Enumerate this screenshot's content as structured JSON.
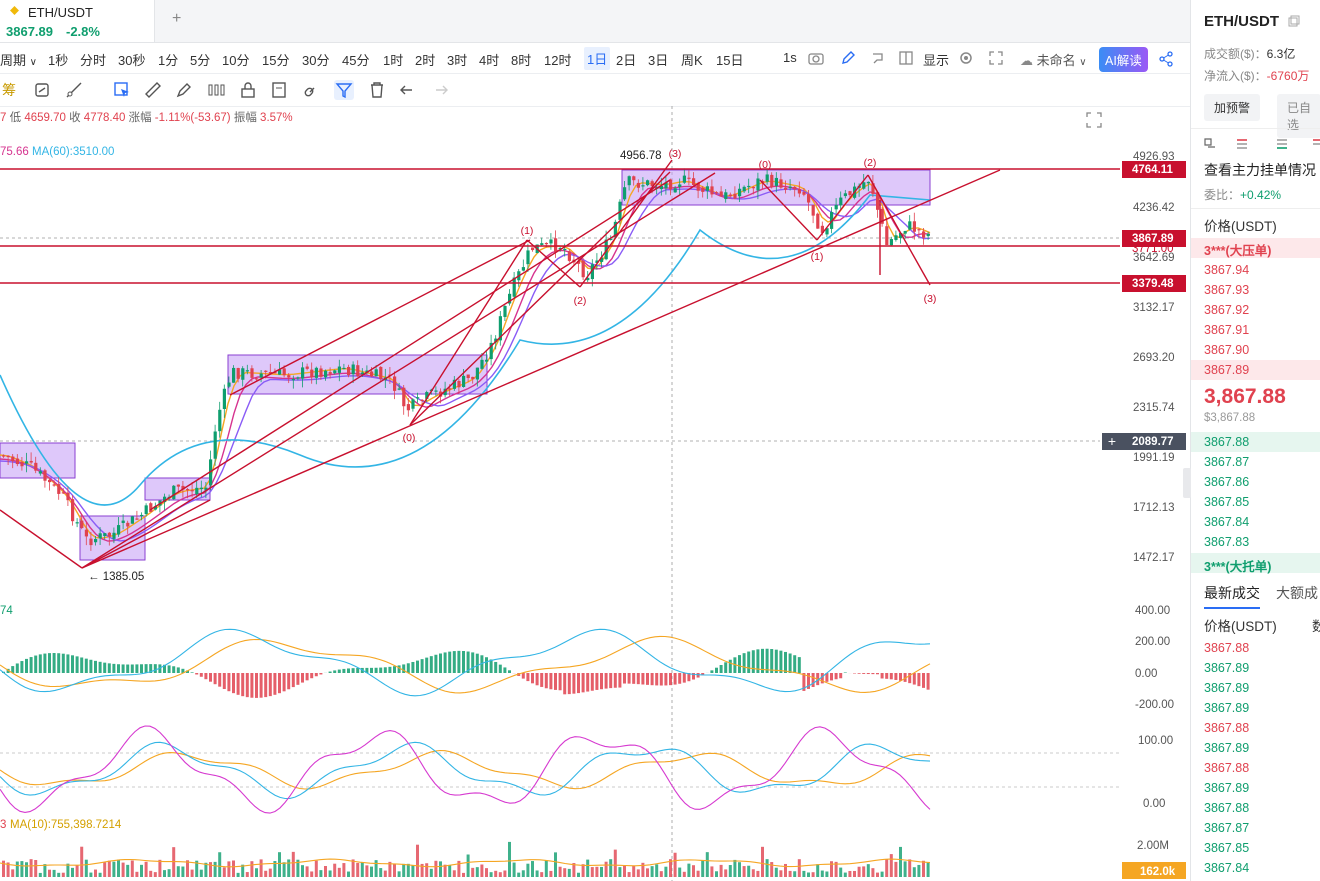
{
  "tab": {
    "symbol": "ETH/USDT",
    "price": "3867.89",
    "change": "-2.8%",
    "add": "+"
  },
  "intervals": [
    "期",
    "1秒",
    "分时",
    "30秒",
    "1分",
    "5分",
    "10分",
    "15分",
    "30分",
    "45分",
    "1时",
    "2时",
    "3时",
    "4时",
    "8时",
    "12时",
    "1日",
    "2日",
    "3日",
    "周K",
    "15日"
  ],
  "interval_active": "1日",
  "interval_prefix": "周期",
  "toolbar_right": {
    "speed": "1s",
    "display": "显示",
    "layout_name": "未命名",
    "ai_button": "AI解读"
  },
  "drawbar": {
    "chip_label": "筹"
  },
  "info": {
    "low_label": "低",
    "low": "4659.70",
    "close_label": "收",
    "close": "4778.40",
    "change_label": "涨幅",
    "change": "-1.11%(-53.67)",
    "amp_label": "振幅",
    "amp": "3.57%",
    "prefix": "7"
  },
  "ma_line": {
    "ma_a": "75.66",
    "ma60": "MA(60):3510.00"
  },
  "macd_label": "74",
  "vol_label_prefix": "3",
  "vol_ma": "MA(10):755,398.7214",
  "annotations": {
    "high": "4956.78",
    "low": "1385.05",
    "wave0a": "(0)",
    "wave1a": "(1)",
    "wave2a": "(2)",
    "wave3a": "(3)",
    "wave0b": "(0)",
    "wave1b": "(1)",
    "wave2b": "(2)",
    "wave3b": "(3)"
  },
  "price_axis": [
    "4926.93",
    "4236.42",
    "3642.69",
    "3132.17",
    "2693.20",
    "2315.74",
    "1991.19",
    "1712.13",
    "1472.17"
  ],
  "price_tags": {
    "resistance": "4764.11",
    "current": "3867.89",
    "support_hidden": "3771.00",
    "support": "3379.48",
    "crosshair": "2089.77",
    "crosshair_plus": "+"
  },
  "macd_axis": [
    "400.00",
    "200.00",
    "0.00",
    "-200.00"
  ],
  "kdj_axis": [
    "100.00",
    "0.00"
  ],
  "vol_axis": [
    "2.00M"
  ],
  "vol_tag": "162.0k",
  "colors": {
    "up": "#0f9e6e",
    "down": "#e0424f",
    "box": "#c39bf5",
    "line": "#c8102e",
    "ma_blue": "#33b5e5",
    "ma_orange": "#f5a623",
    "ma_magenta": "#d6338f",
    "ma_purple": "#8a5cf6"
  },
  "panel": {
    "title": "ETH/USDT",
    "volume_label": "成交额($)：",
    "volume": "6.3亿",
    "inflow_label": "净流入($)：",
    "inflow": "-6760万",
    "alert_btn": "加预警",
    "watch_btn": "已自选",
    "orders_title": "查看主力挂单情况",
    "ratio_label": "委比：",
    "ratio": "+0.42%",
    "price_header": "价格(USDT)",
    "big_ask": "3***(大压单)",
    "asks": [
      "3867.94",
      "3867.93",
      "3867.92",
      "3867.91",
      "3867.90",
      "3867.89"
    ],
    "last_price": "3,867.88",
    "last_usd": "$3,867.88",
    "bids": [
      "3867.88",
      "3867.87",
      "3867.86",
      "3867.85",
      "3867.84",
      "3867.83"
    ],
    "big_bid": "3***(大托单)",
    "trades_tab": "最新成交",
    "big_trades_tab": "大额成",
    "trades_header": "价格(USDT)",
    "trades_header2": "数",
    "trades": [
      {
        "p": "3867.88",
        "side": "sell"
      },
      {
        "p": "3867.89",
        "side": "buy"
      },
      {
        "p": "3867.89",
        "side": "buy"
      },
      {
        "p": "3867.89",
        "side": "buy"
      },
      {
        "p": "3867.88",
        "side": "sell"
      },
      {
        "p": "3867.89",
        "side": "buy"
      },
      {
        "p": "3867.88",
        "side": "sell"
      },
      {
        "p": "3867.89",
        "side": "buy"
      },
      {
        "p": "3867.88",
        "side": "buy"
      },
      {
        "p": "3867.87",
        "side": "buy"
      },
      {
        "p": "3867.85",
        "side": "buy"
      },
      {
        "p": "3867.84",
        "side": "buy"
      }
    ]
  }
}
